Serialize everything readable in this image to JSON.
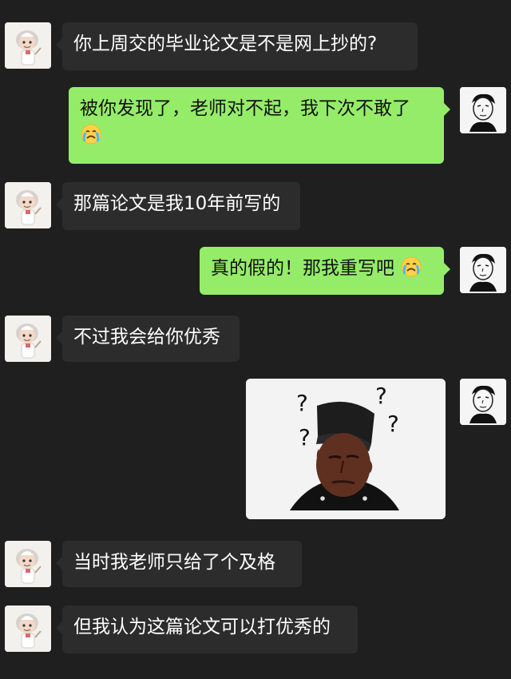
{
  "messages": [
    {
      "id": "m1",
      "side": "left",
      "text": "你上周交的毕业论文是不是网上抄的?"
    },
    {
      "id": "m2",
      "side": "right",
      "text": "被你发现了，老师对不起，我下次不敢了",
      "emoji": "crying-face"
    },
    {
      "id": "m3",
      "side": "left",
      "text": "那篇论文是我10年前写的"
    },
    {
      "id": "m4",
      "side": "right",
      "text": "真的假的！那我重写吧",
      "emoji": "crying-face"
    },
    {
      "id": "m5",
      "side": "left",
      "text": "不过我会给你优秀"
    },
    {
      "id": "m6",
      "side": "right",
      "sticker": "confused-man-sticker",
      "sticker_text": "?"
    },
    {
      "id": "m7",
      "side": "left",
      "text": "当时我老师只给了个及格"
    },
    {
      "id": "m8",
      "side": "left",
      "text": "但我认为这篇论文可以打优秀的"
    }
  ],
  "colors": {
    "background": "#1f1f1f",
    "incoming_bubble": "#2c2c2c",
    "outgoing_bubble": "#95ec69",
    "incoming_text": "#ffffff",
    "outgoing_text": "#111111"
  },
  "icons": {
    "teacher_avatar": "teacher-avatar-icon",
    "student_avatar": "student-avatar-icon",
    "emoji": "crying-face-icon"
  }
}
